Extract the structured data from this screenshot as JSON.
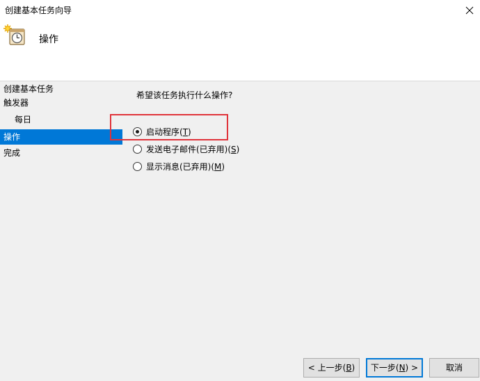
{
  "window": {
    "title": "创建基本任务向导",
    "close_glyph": "✕"
  },
  "header": {
    "title": "操作",
    "icon": "task-clock-icon"
  },
  "steps": [
    {
      "label": "创建基本任务",
      "active": false
    },
    {
      "label": "触发器",
      "active": false
    },
    {
      "label": "每日",
      "active": false
    },
    {
      "label": "操作",
      "active": true
    },
    {
      "label": "完成",
      "active": false
    }
  ],
  "main": {
    "question": "希望该任务执行什么操作?",
    "options": [
      {
        "label_text": "启动程序(",
        "mnemonic": "T",
        "label_tail": ")",
        "selected": true
      },
      {
        "label_text": "发送电子邮件(已弃用)(",
        "mnemonic": "S",
        "label_tail": ")",
        "selected": false
      },
      {
        "label_text": "显示消息(已弃用)(",
        "mnemonic": "M",
        "label_tail": ")",
        "selected": false
      }
    ]
  },
  "buttons": {
    "back": {
      "text": "< 上一步(",
      "mnemonic": "B",
      "tail": ")"
    },
    "next": {
      "text": "下一步(",
      "mnemonic": "N",
      "tail": ") >"
    },
    "cancel": {
      "text": "取消"
    }
  },
  "colors": {
    "accent": "#0078d7",
    "highlight_box": "#e0333a"
  }
}
